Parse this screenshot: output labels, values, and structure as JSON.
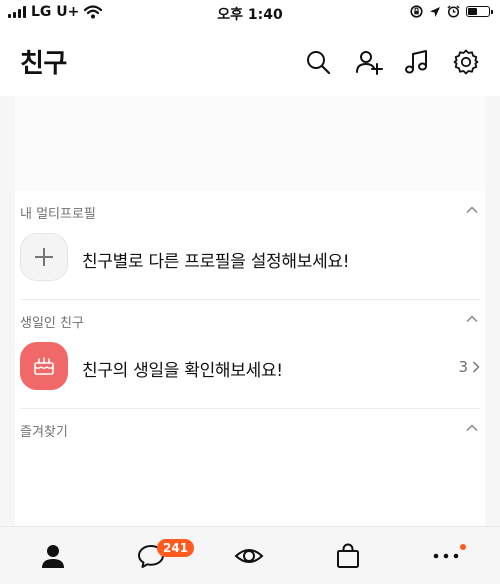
{
  "status_bar": {
    "carrier": "LG U+",
    "time": "오후 1:40"
  },
  "header": {
    "title": "친구"
  },
  "sections": [
    {
      "title": "내 멀티프로필",
      "row_text": "친구별로 다른 프로필을 설정해보세요!",
      "icon": "plus-icon"
    },
    {
      "title": "생일인 친구",
      "row_text": "친구의 생일을 확인해보세요!",
      "icon": "birthday-cake-icon",
      "count": "3"
    },
    {
      "title": "즐겨찾기"
    }
  ],
  "tab_bar": {
    "chat_badge": "241",
    "tabs": [
      "friends-tab",
      "chats-tab",
      "view-tab",
      "shopping-tab",
      "more-tab"
    ]
  },
  "colors": {
    "badge": "#ff5a1f",
    "birthday_icon_bg": "#f06868",
    "section_title": "#707070"
  }
}
